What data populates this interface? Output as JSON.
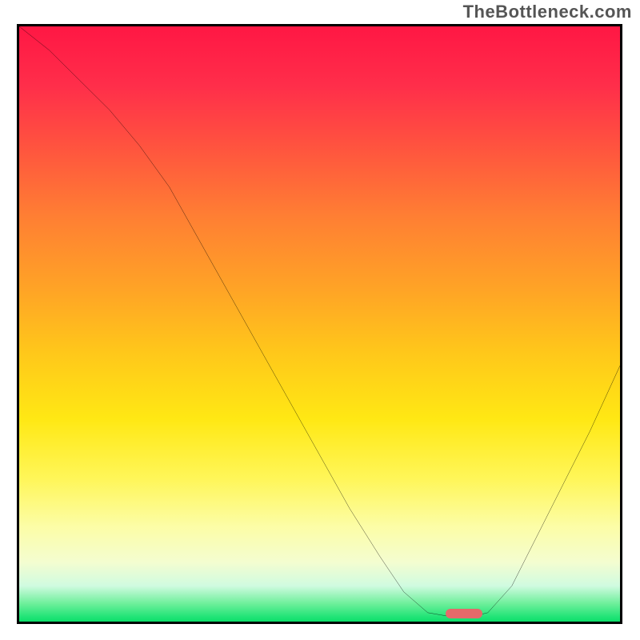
{
  "watermark": "TheBottleneck.com",
  "chart_data": {
    "type": "line",
    "title": "",
    "xlabel": "",
    "ylabel": "",
    "xlim": [
      0,
      100
    ],
    "ylim": [
      0,
      100
    ],
    "series": [
      {
        "name": "curve",
        "x": [
          0,
          5,
          10,
          15,
          20,
          25,
          30,
          35,
          40,
          45,
          50,
          55,
          60,
          64,
          68,
          72,
          76,
          78,
          82,
          86,
          90,
          95,
          100
        ],
        "y": [
          100,
          96,
          91,
          86,
          80,
          73,
          64,
          55,
          46,
          37,
          28,
          19,
          11,
          5,
          1.5,
          0.8,
          1,
          1.5,
          6,
          14,
          22,
          32,
          43
        ]
      }
    ],
    "marker": {
      "x": 74,
      "y": 1.3
    },
    "gradient": {
      "top": "#ff1744",
      "mid": "#ffe814",
      "bottom": "#0bdf6a"
    }
  }
}
